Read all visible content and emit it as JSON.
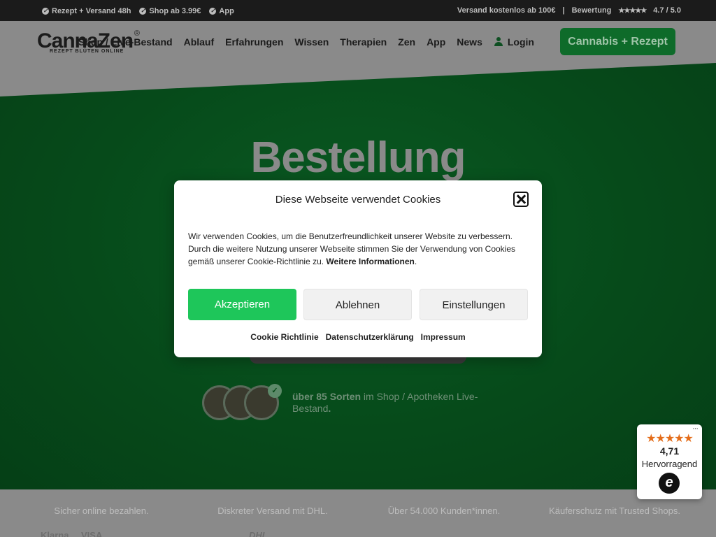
{
  "topbar": {
    "left_items": [
      "Rezept + Versand 48h",
      "Shop ab 3.99€",
      "App"
    ],
    "shipping": "Versand kostenlos ab 100€",
    "separator": "|",
    "rating_label": "Bewertung",
    "rating_stars": "★★★★★",
    "rating_value": "4.7 / 5.0"
  },
  "header": {
    "logo_name": "CannaZen",
    "logo_reg": "®",
    "logo_tagline": "REZEPT BLÜTEN ONLINE",
    "nav": [
      "Shop / Live-Bestand",
      "Ablauf",
      "Erfahrungen",
      "Wissen",
      "Therapien",
      "Zen",
      "App",
      "News"
    ],
    "login": "Login",
    "cta": "Cannabis + Rezept"
  },
  "hero": {
    "title": "Bestellung",
    "sorten_bold": "über 85 Sorten",
    "sorten_rest": " im Shop / Apotheken Live-Bestand",
    "sorten_end": "."
  },
  "trust": {
    "items": [
      "Sicher online bezahlen.",
      "Diskreter Versand mit DHL.",
      "Über 54.000 Kunden*innen.",
      "Käuferschutz mit Trusted Shops."
    ],
    "logos": [
      "Klarna",
      "VISA",
      "DHL"
    ]
  },
  "cookie": {
    "title": "Diese Webseite verwendet Cookies",
    "message": "Wir verwenden Cookies, um die Benutzerfreundlichkeit unserer Website zu verbessern. Durch die weitere Nutzung unserer Webseite stimmen Sie der Verwendung von Cookies gemäß unserer Cookie-Richtlinie zu. ",
    "more_info": "Weitere Informationen",
    "message_end": ".",
    "accept": "Akzeptieren",
    "deny": "Ablehnen",
    "settings": "Einstellungen",
    "links": [
      "Cookie Richtlinie",
      "Datenschutzerklärung",
      "Impressum"
    ]
  },
  "trusted_shops": {
    "dots": "···",
    "stars": "★★★★★",
    "score": "4,71",
    "grade": "Hervorragend",
    "seal": "e"
  }
}
